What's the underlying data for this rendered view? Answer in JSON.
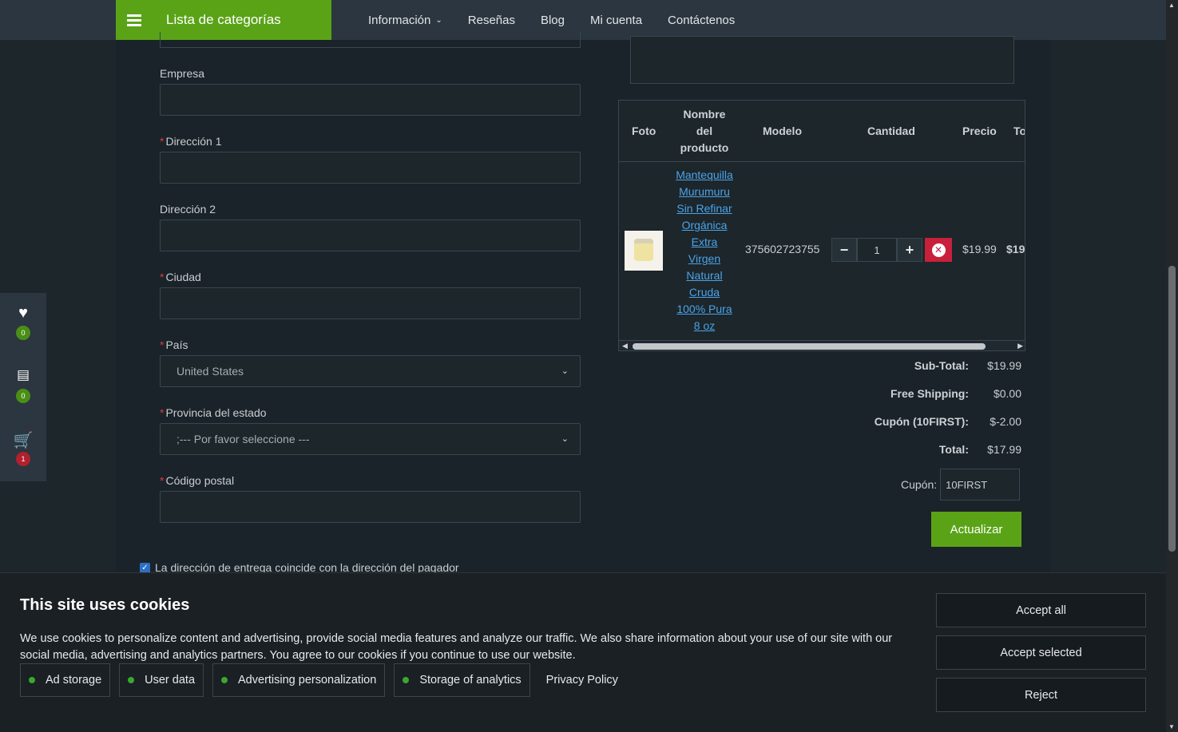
{
  "header": {
    "categories_label": "Lista de categorías",
    "nav": [
      {
        "label": "Información",
        "dropdown": true
      },
      {
        "label": "Reseñas"
      },
      {
        "label": "Blog"
      },
      {
        "label": "Mi cuenta"
      },
      {
        "label": "Contáctenos"
      }
    ]
  },
  "form": {
    "company_label": "Empresa",
    "address1_label": "Dirección 1",
    "address2_label": "Dirección 2",
    "city_label": "Ciudad",
    "country_label": "País",
    "country_value": "United States",
    "state_label": "Provincia del estado",
    "state_value": ";--- Por favor seleccione ---",
    "postcode_label": "Código postal",
    "required_mark": "*",
    "same_address_label": "La dirección de entrega coincide con la dirección del pagador",
    "same_address_checked": true
  },
  "cart": {
    "headers": {
      "photo": "Foto",
      "name_lines": [
        "Nombre",
        "del",
        "producto"
      ],
      "model": "Modelo",
      "qty": "Cantidad",
      "price": "Precio",
      "total": "To"
    },
    "item": {
      "name_lines": [
        "Mantequilla",
        "Murumuru",
        "Sin Refinar",
        "Orgánica",
        "Extra",
        "Virgen",
        "Natural",
        "Cruda",
        "100% Pura",
        "8 oz"
      ],
      "model": "375602723755",
      "qty": "1",
      "price": "$19.99",
      "total": "$19"
    },
    "totals": [
      {
        "label": "Sub-Total:",
        "value": "$19.99"
      },
      {
        "label": "Free Shipping:",
        "value": "$0.00"
      },
      {
        "label": "Cupón (10FIRST):",
        "value": "$-2.00"
      },
      {
        "label": "Total:",
        "value": "$17.99"
      }
    ],
    "coupon_label": "Cupón:",
    "coupon_value": "10FIRST",
    "update_label": "Actualizar"
  },
  "side_widget": {
    "wishlist_count": "0",
    "compare_count": "0",
    "cart_count": "1"
  },
  "cookie_banner": {
    "title": "This site uses cookies",
    "description": "We use cookies to personalize content and advertising, provide social media features and analyze our traffic. We also share information about your use of our site with our social media, advertising and analytics partners. You agree to our cookies if you continue to use our website.",
    "options": [
      "Ad storage",
      "User data",
      "Advertising personalization",
      "Storage of analytics"
    ],
    "privacy_label": "Privacy Policy",
    "accept_all": "Accept all",
    "accept_selected": "Accept selected",
    "reject": "Reject"
  },
  "colors": {
    "accent_green": "#5aa317",
    "remove_red": "#c8203b",
    "link_blue": "#4ba3e8"
  }
}
